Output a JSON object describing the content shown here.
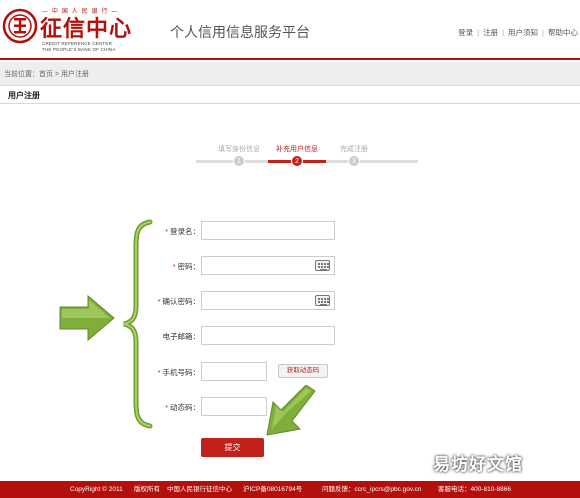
{
  "header": {
    "logo": {
      "slogan": "— 中 国 人 民 银 行 —",
      "name": "征信中心",
      "en_line1": "CREDIT REFERENCE CENTER",
      "en_line2": "THE PEOPLE'S BANK OF CHINA"
    },
    "site_title": "个人信用信息服务平台",
    "nav": {
      "login": "登录",
      "register": "注册",
      "manual": "用户须知",
      "help": "帮助中心"
    }
  },
  "breadcrumb": "当前位置：首页 > 用户注册",
  "section_title": "用户注册",
  "steps": [
    {
      "label": "填写身份信息",
      "num": "1"
    },
    {
      "label": "补充用户信息",
      "num": "2"
    },
    {
      "label": "完成注册",
      "num": "3"
    }
  ],
  "form": {
    "required_mark": "*",
    "login_name": {
      "label": "登录名：",
      "value": ""
    },
    "password": {
      "label": "密码：",
      "value": ""
    },
    "confirm_password": {
      "label": "确认密码：",
      "value": ""
    },
    "email": {
      "label": "电子邮箱：",
      "value": ""
    },
    "mobile": {
      "label": "手机号码：",
      "value": ""
    },
    "dynamic_code": {
      "label": "动态码：",
      "value": ""
    },
    "get_code_button": "获取动态码",
    "submit_button": "提交"
  },
  "footer": {
    "copyright": "CopyRight © 2011",
    "rights": "版权所有",
    "org": "中国人民银行征信中心",
    "icp": "沪ICP备08016794号",
    "feedback": "问题反馈：ccrc_ipcrs@pbc.gov.cn",
    "hotline": "客服电话：400-810-8866"
  },
  "watermark": "易坊好文馆",
  "colors": {
    "brand_red": "#b3100c",
    "accent_red": "#c0211b",
    "arrow_green": "#7fae3a"
  }
}
